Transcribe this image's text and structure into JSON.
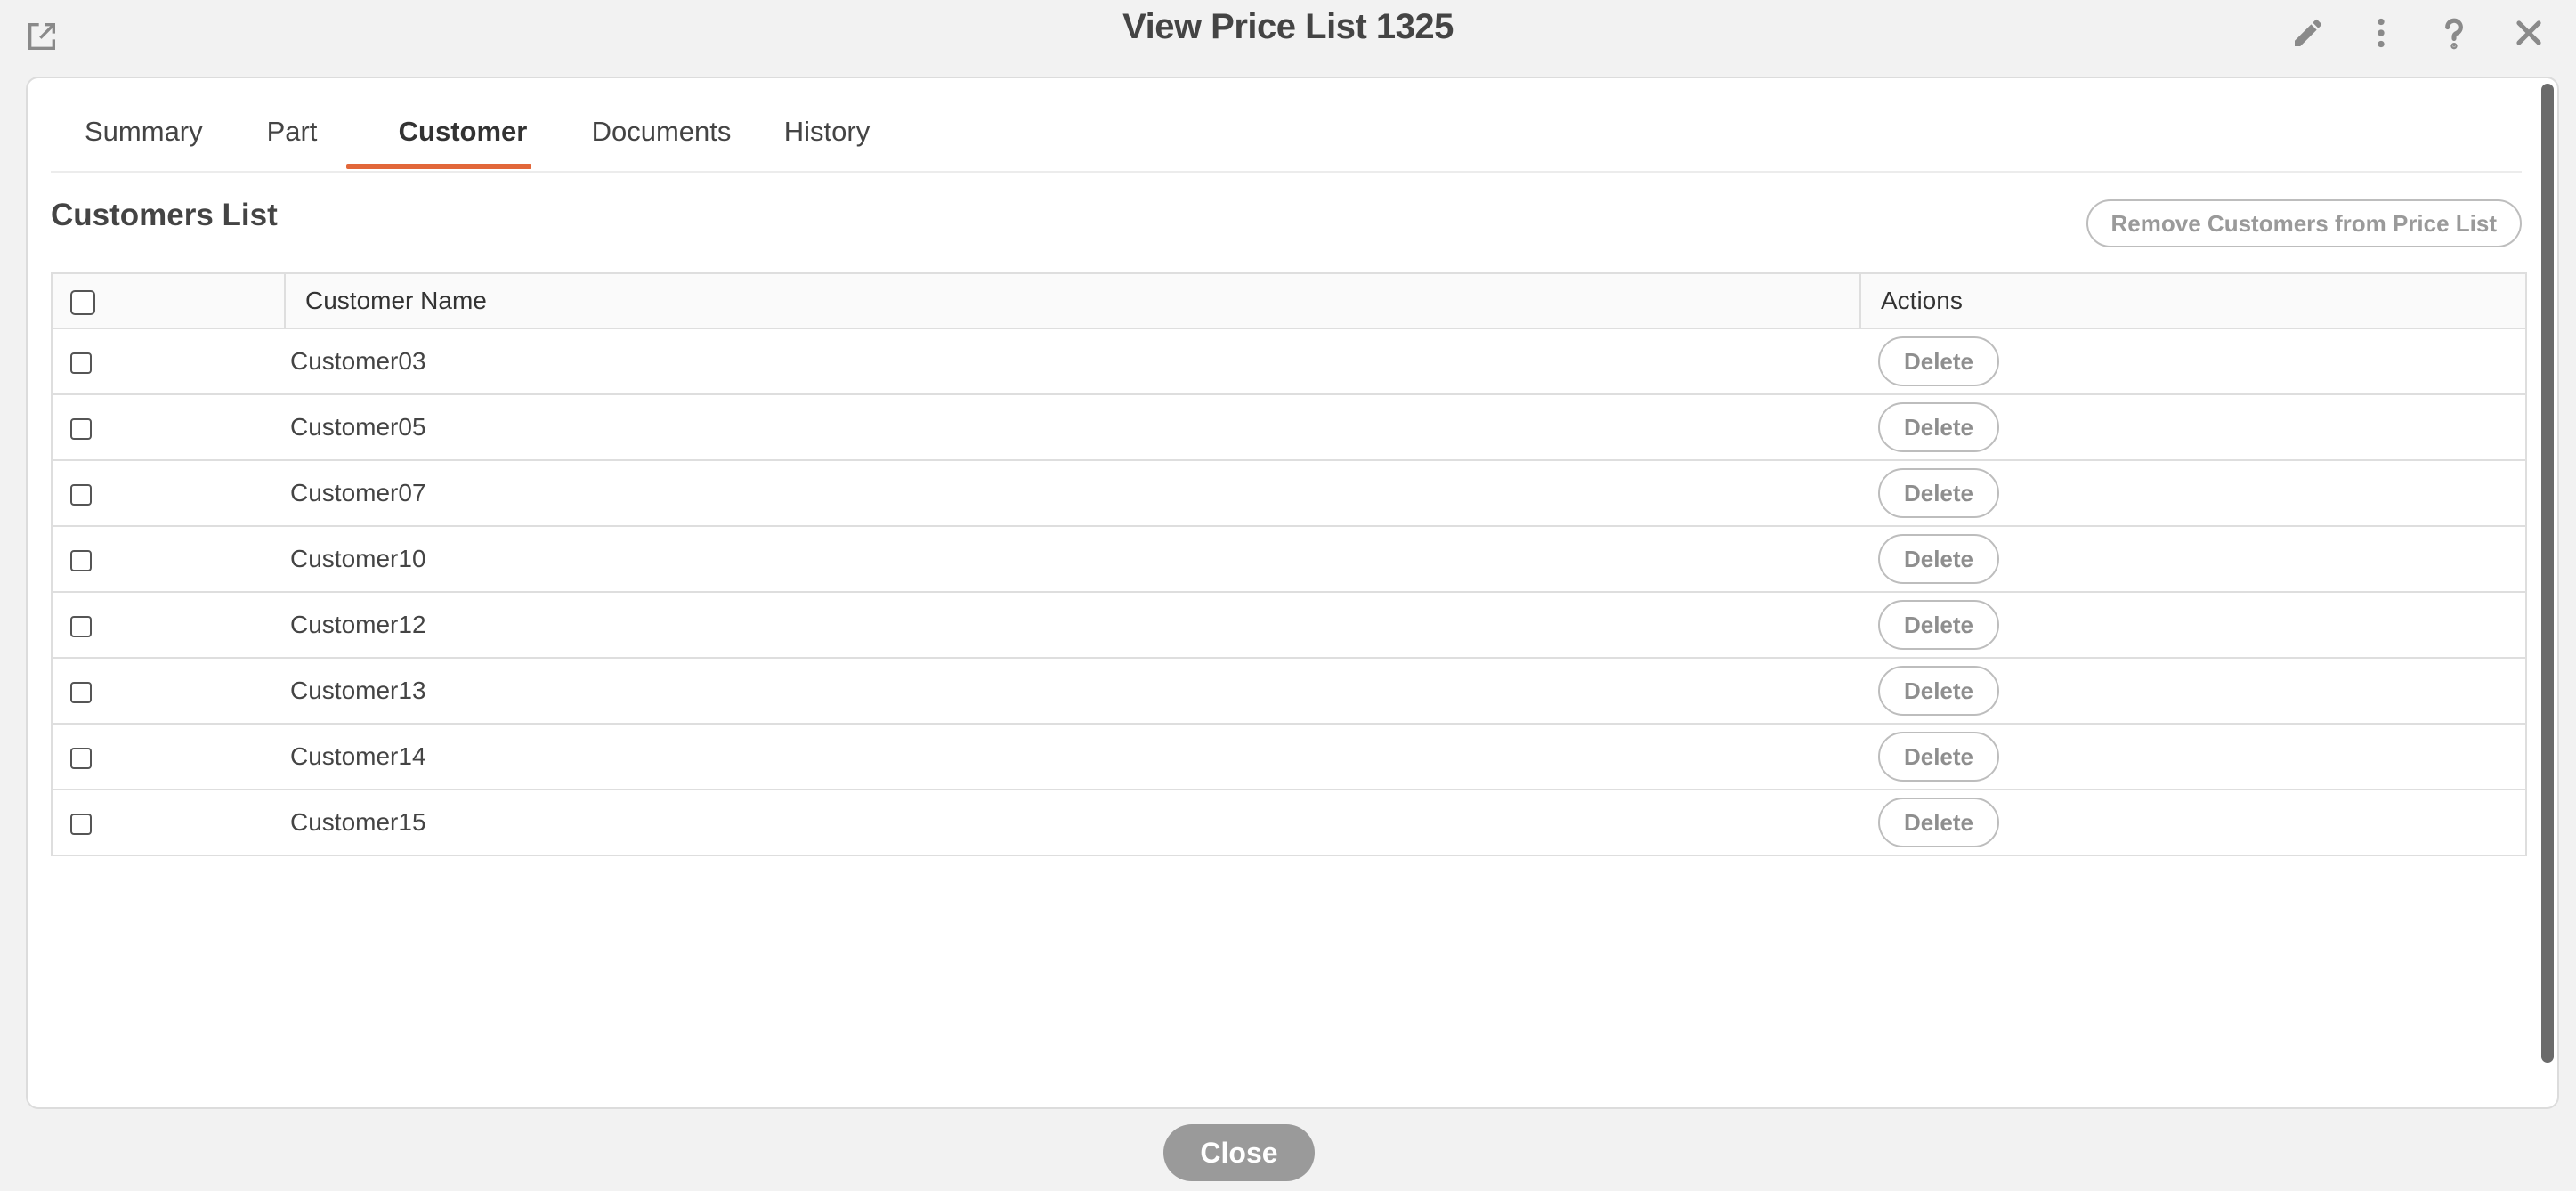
{
  "header": {
    "title": "View Price List  1325",
    "icons": [
      "open-external-icon",
      "pencil-icon",
      "more-vertical-icon",
      "help-icon",
      "close-icon"
    ]
  },
  "tabs": [
    {
      "label": "Summary",
      "active": false
    },
    {
      "label": "Part",
      "active": false
    },
    {
      "label": "Customer",
      "active": true
    },
    {
      "label": "Documents",
      "active": false
    },
    {
      "label": "History",
      "active": false
    }
  ],
  "section": {
    "title": "Customers List",
    "remove_button": "Remove Customers from Price List"
  },
  "table": {
    "columns": [
      "",
      "Customer Name",
      "Actions"
    ],
    "rows": [
      {
        "name": "Customer03",
        "action": "Delete"
      },
      {
        "name": "Customer05",
        "action": "Delete"
      },
      {
        "name": "Customer07",
        "action": "Delete"
      },
      {
        "name": "Customer10",
        "action": "Delete"
      },
      {
        "name": "Customer12",
        "action": "Delete"
      },
      {
        "name": "Customer13",
        "action": "Delete"
      },
      {
        "name": "Customer14",
        "action": "Delete"
      },
      {
        "name": "Customer15",
        "action": "Delete"
      }
    ]
  },
  "footer": {
    "close_label": "Close"
  },
  "colors": {
    "accent": "#e2673a",
    "background": "#f2f2f2",
    "close_button": "#9a9a9a"
  }
}
